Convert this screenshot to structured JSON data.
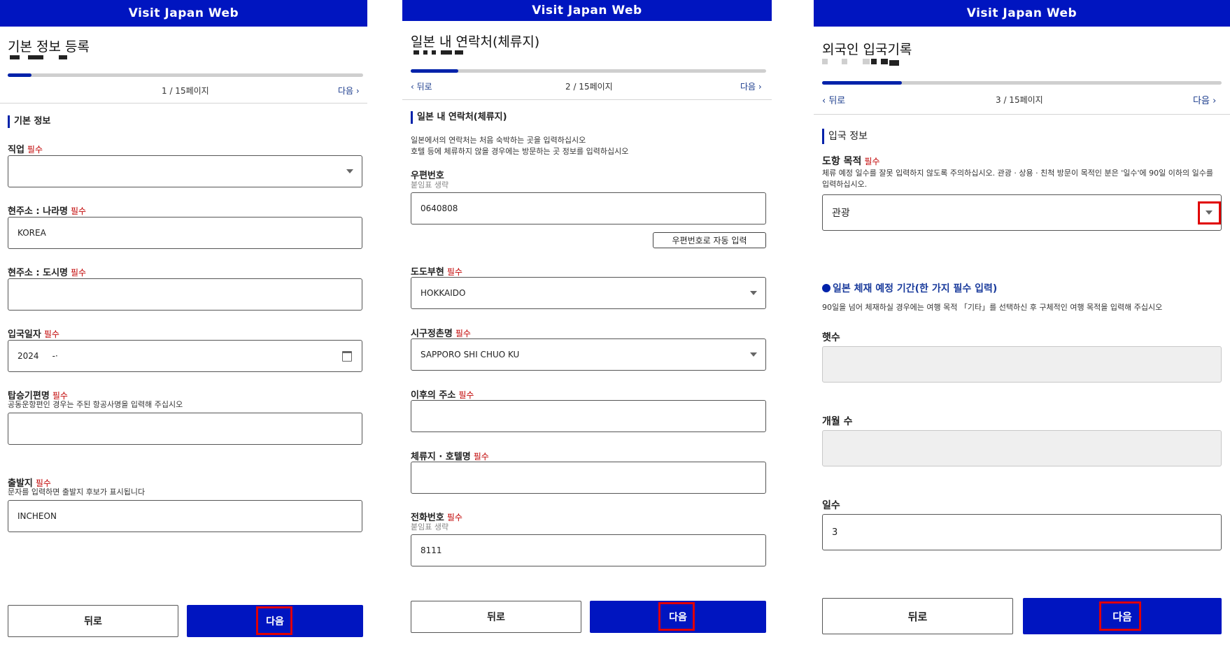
{
  "header_title": "Visit Japan Web",
  "panel1": {
    "title": "기본 정보 등록",
    "progress": 0.067,
    "page_indicator": "1 / 15페이지",
    "next_link": "다음",
    "section": "기본 정보",
    "required": "필수",
    "fields": {
      "occupation_label": "직업",
      "country_label": "현주소 : 나라명",
      "country_value": "KOREA",
      "city_label": "현주소 : 도시명",
      "city_value": "",
      "entry_date_label": "입국일자",
      "entry_date_value": "2024     -·",
      "flight_label": "탑승기편명",
      "flight_help": "공동운항편인 경우는 주된 항공사명을 입력해 주십시오",
      "departure_label": "출발지",
      "departure_help": "문자를 입력하면 출발지 후보가 표시됩니다",
      "departure_value": "INCHEON"
    },
    "back_button": "뒤로",
    "next_button": "다음"
  },
  "panel2": {
    "title": "일본 내 연락처(체류지)",
    "progress": 0.133,
    "back_link": "뒤로",
    "page_indicator": "2 / 15페이지",
    "next_link": "다음",
    "section": "일본 내 연락처(체류지)",
    "description_line1": "일본에서의 연락처는 처음 숙박하는 곳을 입력하십시오",
    "description_line2": "호텔 등에 체류하지 않을 경우에는 방문하는 곳 정보를 입력하십시오",
    "required": "필수",
    "fields": {
      "postal_label": "우편번호",
      "postal_hint": "붙임표 생략",
      "postal_value": "0640808",
      "autofill_button": "우편번호로 자동 입력",
      "prefecture_label": "도도부현",
      "prefecture_value": "HOKKAIDO",
      "city_label": "시구정촌명",
      "city_value": "SAPPORO SHI CHUO KU",
      "address_label": "이후의 주소",
      "hotel_label": "체류지 · 호텔명",
      "phone_label": "전화번호",
      "phone_hint": "붙임표 생략",
      "phone_value": "8111"
    },
    "back_button": "뒤로",
    "next_button": "다음"
  },
  "panel3": {
    "title": "외국인 입국기록",
    "progress": 0.2,
    "back_link": "뒤로",
    "page_indicator": "3 / 15페이지",
    "next_link": "다음",
    "section": "입국 정보",
    "required": "필수",
    "purpose_label": "도항 목적",
    "purpose_help": "체류 예정 일수를 잘못 입력하지 않도록 주의하십시오. 관광 · 상용 · 친척 방문이 목적인 분은 '일수'에 90일 이하의 일수를 입력하십시오.",
    "purpose_value": "관광",
    "stay_heading": "일본 체재 예정 기간(한 가지 필수 입력)",
    "stay_help": "90일을 넘어 체재하실 경우에는 여행 목적 「기타」를 선택하신 후 구체적인 여행 목적을 입력해 주십시오",
    "years_label": "햇수",
    "months_label": "개월 수",
    "days_label": "일수",
    "days_value": "3",
    "back_button": "뒤로",
    "next_button": "다음"
  },
  "colors": {
    "brand_blue": "#0015c0",
    "required_red": "#c00000",
    "highlight_red": "#e00000"
  }
}
